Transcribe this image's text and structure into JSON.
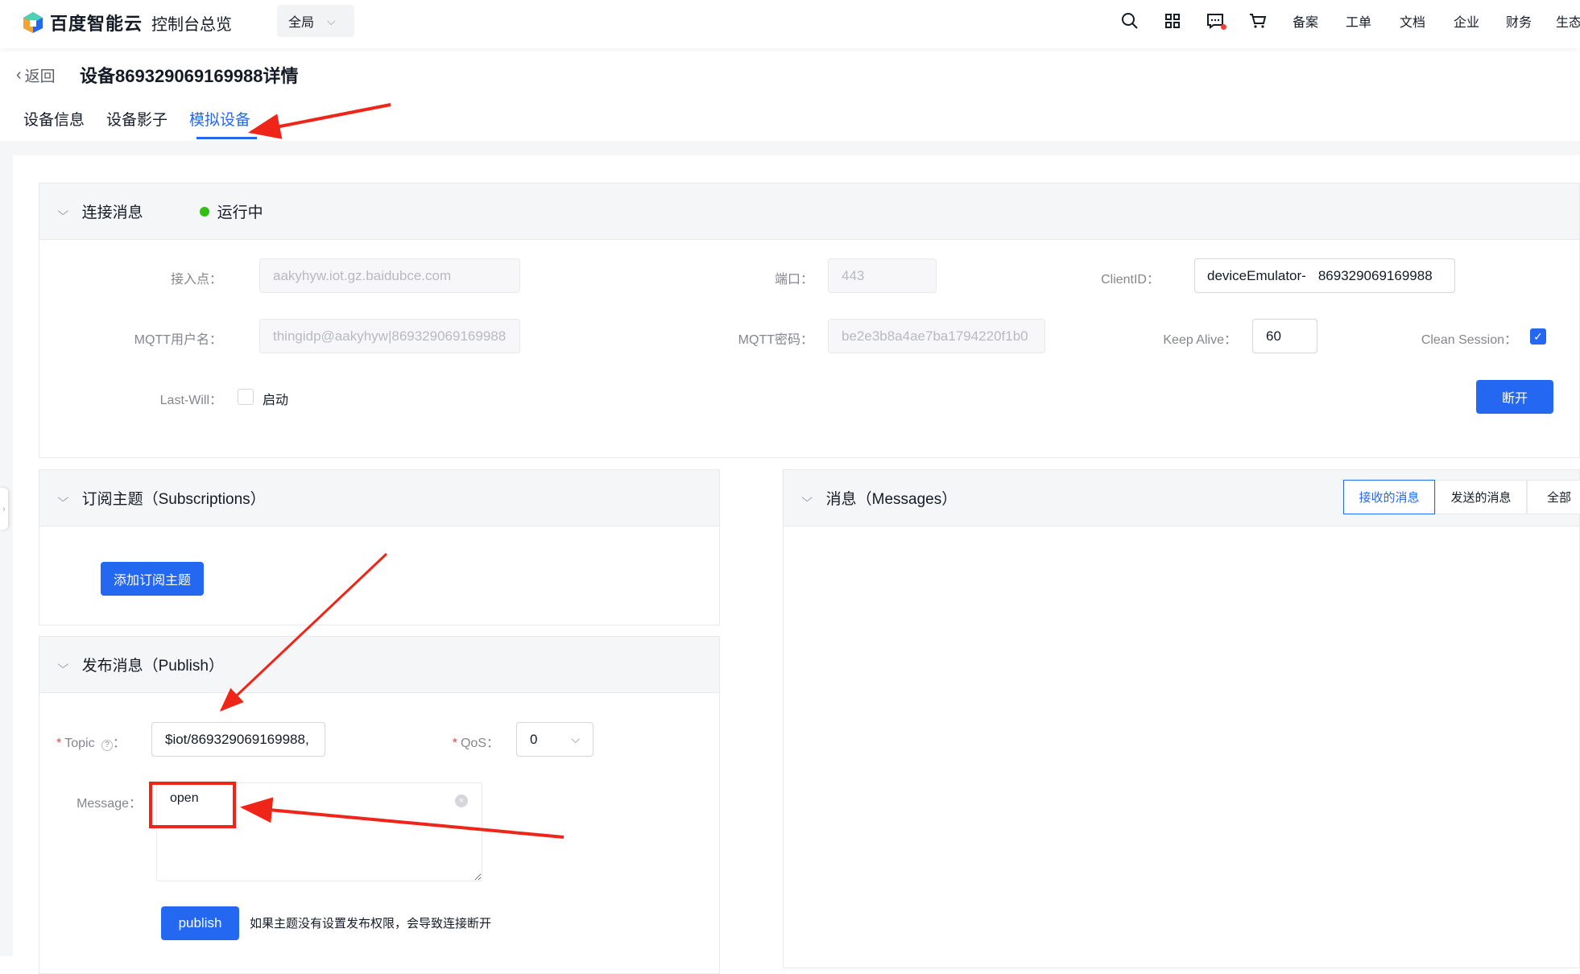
{
  "brand": {
    "name": "百度智能云"
  },
  "header": {
    "console_title": "控制台总览",
    "region": "全局",
    "nav": [
      "备案",
      "工单",
      "文档",
      "企业",
      "财务",
      "生态"
    ]
  },
  "page": {
    "back_label": "返回",
    "title": "设备869329069169988详情",
    "tabs": [
      "设备信息",
      "设备影子",
      "模拟设备"
    ],
    "active_tab": 2
  },
  "connection": {
    "title": "连接消息",
    "status": "运行中",
    "endpoint_label": "接入点：",
    "endpoint_value": "aakyhyw.iot.gz.baidubce.com",
    "port_label": "端口：",
    "port_value": "443",
    "client_id_label": "ClientID：",
    "client_id_prefix": "deviceEmulator-",
    "client_id_value": "869329069169988",
    "username_label": "MQTT用户名：",
    "username_value": "thingidp@aakyhyw|869329069169988",
    "password_label": "MQTT密码：",
    "password_value": "be2e3b8a4ae7ba1794220f1b0",
    "keepalive_label": "Keep Alive：",
    "keepalive_value": "60",
    "clean_session_label": "Clean Session：",
    "clean_session_checked": true,
    "lastwill_label": "Last-Will：",
    "lastwill_option": "启动",
    "disconnect_label": "断开"
  },
  "subscriptions": {
    "title": "订阅主题（Subscriptions）",
    "add_label": "添加订阅主题"
  },
  "publish": {
    "title": "发布消息（Publish）",
    "topic_label": "Topic",
    "topic_value": "$iot/869329069169988,",
    "qos_label": "QoS：",
    "qos_value": "0",
    "message_label": "Message：",
    "message_value": "open",
    "publish_label": "publish",
    "hint": "如果主题没有设置发布权限，会导致连接断开"
  },
  "messages": {
    "title": "消息（Messages）",
    "filters": [
      "接收的消息",
      "发送的消息",
      "全部"
    ],
    "active_filter": 0
  },
  "colors": {
    "accent": "#2468f2",
    "status_green": "#30bf13",
    "annotation_red": "#f0251a"
  }
}
